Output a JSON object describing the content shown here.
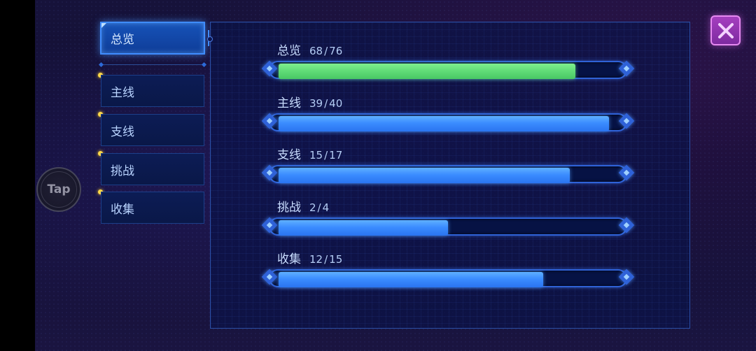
{
  "tabs": [
    {
      "label": "总览",
      "active": true
    },
    {
      "label": "主线",
      "active": false,
      "has_dot": true
    },
    {
      "label": "支线",
      "active": false,
      "has_dot": true
    },
    {
      "label": "挑战",
      "active": false,
      "has_dot": true
    },
    {
      "label": "收集",
      "active": false,
      "has_dot": true
    }
  ],
  "progress": [
    {
      "category": "总览",
      "current": "68",
      "separator": "/",
      "total": "76",
      "fraction": 0.875,
      "color": "green"
    },
    {
      "category": "主线",
      "current": "39",
      "separator": "/",
      "total": "40",
      "fraction": 0.975,
      "color": "blue"
    },
    {
      "category": "支线",
      "current": "15",
      "separator": "/",
      "total": "17",
      "fraction": 0.86,
      "color": "blue"
    },
    {
      "category": "挑战",
      "current": "2",
      "separator": "/",
      "total": "4",
      "fraction": 0.5,
      "color": "blue"
    },
    {
      "category": "收集",
      "current": "12",
      "separator": "/",
      "total": "15",
      "fraction": 0.78,
      "color": "blue"
    }
  ],
  "tap_button": {
    "label": "Tap"
  },
  "colors": {
    "accent_blue": "#3b8cff",
    "accent_green": "#5fdb76",
    "tab_dot": "#ffd84a",
    "close_button": "#a53fbf"
  },
  "icons": {
    "close": "close-icon"
  }
}
